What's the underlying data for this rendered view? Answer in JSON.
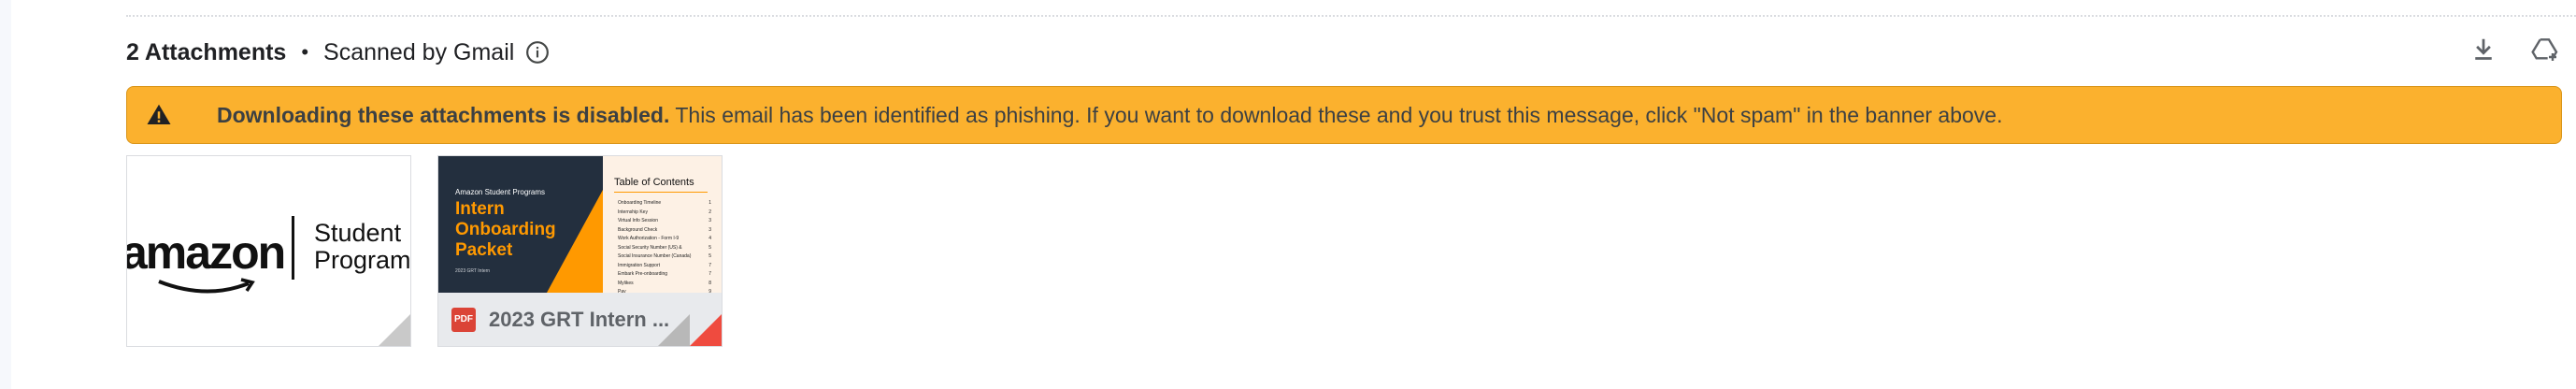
{
  "attachments_header": {
    "count_label": "2 Attachments",
    "separator": "•",
    "scanned_label": "Scanned by Gmail",
    "info_icon": "info-icon"
  },
  "toolbar": {
    "download_all_icon": "download-icon",
    "save_to_drive_icon": "add-to-drive-icon"
  },
  "warning_banner": {
    "icon": "warning-icon",
    "bold_text": "Downloading these attachments is disabled.",
    "body_text": " This email has been identified as phishing. If you want to download these and you trust this message, click \"Not spam\" in the banner above.",
    "background_color": "#fbb12e"
  },
  "attachments": [
    {
      "type": "image",
      "logo_wordmark": "amazon",
      "logo_caption_line1": "Student",
      "logo_caption_line2": "Program"
    },
    {
      "type": "pdf",
      "file_type_label": "PDF",
      "caption": "2023 GRT Intern ...",
      "preview": {
        "kicker": "Amazon Student Programs",
        "title_lines": [
          "Intern",
          "Onboarding",
          "Packet"
        ],
        "subtitle": "2023 GRT Intern",
        "toc_title": "Table of Contents",
        "toc_items": [
          {
            "label": "Onboarding Timeline",
            "page": "1"
          },
          {
            "label": "Internship Key",
            "page": "2"
          },
          {
            "label": "Virtual Info Session",
            "page": "3"
          },
          {
            "label": "Background Check",
            "page": "3"
          },
          {
            "label": "Work Authorization - Form I-9",
            "page": "4"
          },
          {
            "label": "Social Security Number (US) &",
            "page": "5"
          },
          {
            "label": "Social Insurance Number (Canada)",
            "page": "5"
          },
          {
            "label": "Immigration Support",
            "page": "7"
          },
          {
            "label": "Embark Pre-onboarding",
            "page": "7"
          },
          {
            "label": "Mylikes",
            "page": "8"
          },
          {
            "label": "Pay",
            "page": "9"
          }
        ]
      }
    }
  ]
}
